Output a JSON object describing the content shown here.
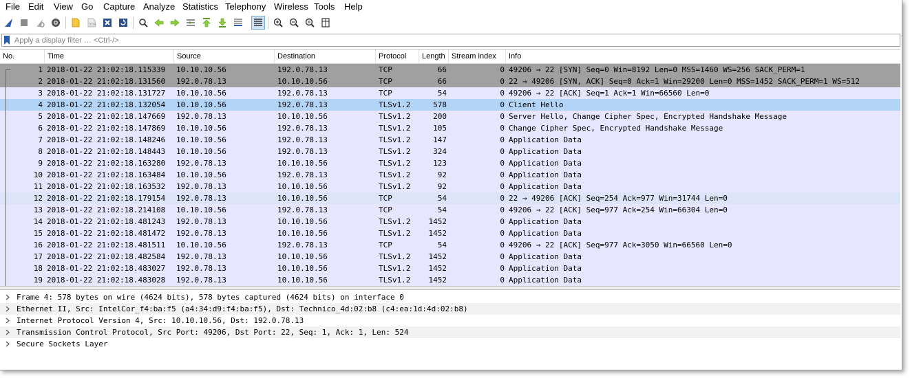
{
  "menu": [
    "File",
    "Edit",
    "View",
    "Go",
    "Capture",
    "Analyze",
    "Statistics",
    "Telephony",
    "Wireless",
    "Tools",
    "Help"
  ],
  "toolbar": {
    "buttons": [
      "shark-fin-start-icon",
      "stop-capture-icon",
      "restart-capture-icon",
      "capture-options-icon",
      "open-file-icon",
      "save-file-icon",
      "close-file-icon",
      "reload-file-icon",
      "find-packet-icon",
      "go-back-icon",
      "go-forward-icon",
      "go-to-packet-icon",
      "go-first-icon",
      "go-last-icon",
      "autoscroll-icon",
      "colorize-icon",
      "zoom-in-icon",
      "zoom-out-icon",
      "zoom-normal-icon",
      "resize-columns-icon"
    ]
  },
  "filter": {
    "placeholder": "Apply a display filter … <Ctrl-/>"
  },
  "columns": [
    "No.",
    "Time",
    "Source",
    "Destination",
    "Protocol",
    "Length",
    "Stream index",
    "Info"
  ],
  "colors": {
    "tcp_syn_bg": "#a0a0a0",
    "tcp_bg": "#e7e6ff",
    "selected_bg": "#b2d4f7",
    "ack_bg": "#dbe5f7"
  },
  "packets": [
    {
      "no": "1",
      "time": "2018-01-22 21:02:18.115339",
      "src": "10.10.10.56",
      "dst": "192.0.78.13",
      "proto": "TCP",
      "len": "66",
      "stream": "0",
      "info": "49206 → 22 [SYN] Seq=0 Win=8192 Len=0 MSS=1460 WS=256 SACK_PERM=1",
      "style": "syn"
    },
    {
      "no": "2",
      "time": "2018-01-22 21:02:18.131560",
      "src": "192.0.78.13",
      "dst": "10.10.10.56",
      "proto": "TCP",
      "len": "66",
      "stream": "0",
      "info": "22 → 49206 [SYN, ACK] Seq=0 Ack=1 Win=29200 Len=0 MSS=1452 SACK_PERM=1 WS=512",
      "style": "syn"
    },
    {
      "no": "3",
      "time": "2018-01-22 21:02:18.131727",
      "src": "10.10.10.56",
      "dst": "192.0.78.13",
      "proto": "TCP",
      "len": "54",
      "stream": "0",
      "info": "49206 → 22 [ACK] Seq=1 Ack=1 Win=66560 Len=0",
      "style": "normal"
    },
    {
      "no": "4",
      "time": "2018-01-22 21:02:18.132054",
      "src": "10.10.10.56",
      "dst": "192.0.78.13",
      "proto": "TLSv1.2",
      "len": "578",
      "stream": "0",
      "info": "Client Hello",
      "style": "selected"
    },
    {
      "no": "5",
      "time": "2018-01-22 21:02:18.147669",
      "src": "192.0.78.13",
      "dst": "10.10.10.56",
      "proto": "TLSv1.2",
      "len": "200",
      "stream": "0",
      "info": "Server Hello, Change Cipher Spec, Encrypted Handshake Message",
      "style": "normal"
    },
    {
      "no": "6",
      "time": "2018-01-22 21:02:18.147869",
      "src": "10.10.10.56",
      "dst": "192.0.78.13",
      "proto": "TLSv1.2",
      "len": "105",
      "stream": "0",
      "info": "Change Cipher Spec, Encrypted Handshake Message",
      "style": "normal"
    },
    {
      "no": "7",
      "time": "2018-01-22 21:02:18.148246",
      "src": "10.10.10.56",
      "dst": "192.0.78.13",
      "proto": "TLSv1.2",
      "len": "147",
      "stream": "0",
      "info": "Application Data",
      "style": "normal"
    },
    {
      "no": "8",
      "time": "2018-01-22 21:02:18.148443",
      "src": "10.10.10.56",
      "dst": "192.0.78.13",
      "proto": "TLSv1.2",
      "len": "324",
      "stream": "0",
      "info": "Application Data",
      "style": "normal"
    },
    {
      "no": "9",
      "time": "2018-01-22 21:02:18.163280",
      "src": "192.0.78.13",
      "dst": "10.10.10.56",
      "proto": "TLSv1.2",
      "len": "123",
      "stream": "0",
      "info": "Application Data",
      "style": "normal"
    },
    {
      "no": "10",
      "time": "2018-01-22 21:02:18.163484",
      "src": "10.10.10.56",
      "dst": "192.0.78.13",
      "proto": "TLSv1.2",
      "len": "92",
      "stream": "0",
      "info": "Application Data",
      "style": "normal"
    },
    {
      "no": "11",
      "time": "2018-01-22 21:02:18.163532",
      "src": "192.0.78.13",
      "dst": "10.10.10.56",
      "proto": "TLSv1.2",
      "len": "92",
      "stream": "0",
      "info": "Application Data",
      "style": "normal"
    },
    {
      "no": "12",
      "time": "2018-01-22 21:02:18.179154",
      "src": "192.0.78.13",
      "dst": "10.10.10.56",
      "proto": "TCP",
      "len": "54",
      "stream": "0",
      "info": "22 → 49206 [ACK] Seq=254 Ack=977 Win=31744 Len=0",
      "style": "ack"
    },
    {
      "no": "13",
      "time": "2018-01-22 21:02:18.214108",
      "src": "10.10.10.56",
      "dst": "192.0.78.13",
      "proto": "TCP",
      "len": "54",
      "stream": "0",
      "info": "49206 → 22 [ACK] Seq=977 Ack=254 Win=66304 Len=0",
      "style": "normal"
    },
    {
      "no": "14",
      "time": "2018-01-22 21:02:18.481243",
      "src": "192.0.78.13",
      "dst": "10.10.10.56",
      "proto": "TLSv1.2",
      "len": "1452",
      "stream": "0",
      "info": "Application Data",
      "style": "normal"
    },
    {
      "no": "15",
      "time": "2018-01-22 21:02:18.481472",
      "src": "192.0.78.13",
      "dst": "10.10.10.56",
      "proto": "TLSv1.2",
      "len": "1452",
      "stream": "0",
      "info": "Application Data",
      "style": "normal"
    },
    {
      "no": "16",
      "time": "2018-01-22 21:02:18.481511",
      "src": "10.10.10.56",
      "dst": "192.0.78.13",
      "proto": "TCP",
      "len": "54",
      "stream": "0",
      "info": "49206 → 22 [ACK] Seq=977 Ack=3050 Win=66560 Len=0",
      "style": "normal"
    },
    {
      "no": "17",
      "time": "2018-01-22 21:02:18.482584",
      "src": "192.0.78.13",
      "dst": "10.10.10.56",
      "proto": "TLSv1.2",
      "len": "1452",
      "stream": "0",
      "info": "Application Data",
      "style": "normal"
    },
    {
      "no": "18",
      "time": "2018-01-22 21:02:18.483027",
      "src": "192.0.78.13",
      "dst": "10.10.10.56",
      "proto": "TLSv1.2",
      "len": "1452",
      "stream": "0",
      "info": "Application Data",
      "style": "normal"
    },
    {
      "no": "19",
      "time": "2018-01-22 21:02:18.483028",
      "src": "192.0.78.13",
      "dst": "10.10.10.56",
      "proto": "TLSv1.2",
      "len": "1452",
      "stream": "0",
      "info": "Application Data",
      "style": "normal"
    }
  ],
  "details": [
    "Frame 4: 578 bytes on wire (4624 bits), 578 bytes captured (4624 bits) on interface 0",
    "Ethernet II, Src: IntelCor_f4:ba:f5 (a4:34:d9:f4:ba:f5), Dst: Technico_4d:02:b8 (c4:ea:1d:4d:02:b8)",
    "Internet Protocol Version 4, Src: 10.10.10.56, Dst: 192.0.78.13",
    "Transmission Control Protocol, Src Port: 49206, Dst Port: 22, Seq: 1, Ack: 1, Len: 524",
    "Secure Sockets Layer"
  ]
}
